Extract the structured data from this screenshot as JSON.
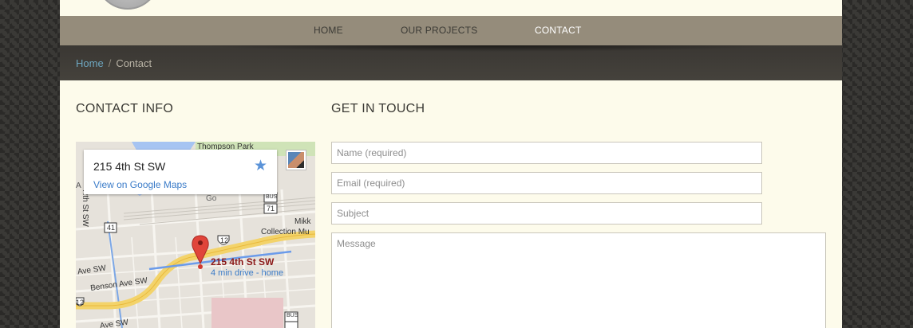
{
  "nav": {
    "items": [
      "HOME",
      "OUR PROJECTS",
      "CONTACT"
    ],
    "active": "CONTACT"
  },
  "breadcrumb": {
    "home": "Home",
    "separator": "/",
    "current": "Contact"
  },
  "contact_info": {
    "heading": "CONTACT INFO",
    "map": {
      "address": "215 4th St SW",
      "view_link": "View on Google Maps",
      "pin_title": "215 4th St SW",
      "pin_subtitle": "4 min drive - home",
      "labels": {
        "thompson_park": "Thompson Park",
        "collection": "Collection Mu",
        "mikk": "Mikk",
        "benson": "Benson Ave SW",
        "ave_sw": "Ave SW",
        "ave_sw_bottom": "Ave SW",
        "rth_st": "Rth St SW",
        "route41": "41",
        "route12": "12",
        "route12b": "12",
        "route71": "71",
        "bus": "BUS",
        "bus2": "BUS",
        "go": "Go",
        "a_st": "A"
      }
    }
  },
  "get_in_touch": {
    "heading": "GET IN TOUCH",
    "name_placeholder": "Name (required)",
    "email_placeholder": "Email (required)",
    "subject_placeholder": "Subject",
    "message_placeholder": "Message"
  },
  "colors": {
    "navbar": "#958c7b",
    "breadcrumb_bar": "#3f3c37",
    "page_bg": "#fdfbeb",
    "link": "#6ea7c0",
    "map_link": "#3a7bc8"
  }
}
